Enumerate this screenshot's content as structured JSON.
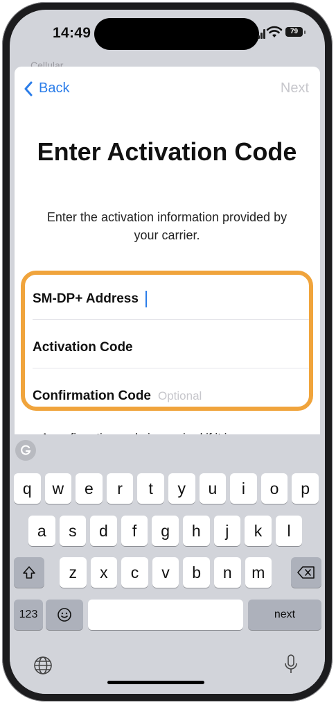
{
  "status": {
    "time": "14:49",
    "battery": "79"
  },
  "behind_title": "Cellular",
  "nav": {
    "back_label": "Back",
    "next_label": "Next"
  },
  "page": {
    "title": "Enter Activation Code",
    "subtitle": "Enter the activation information provided by your carrier."
  },
  "form": {
    "smdp_label": "SM-DP+ Address",
    "activation_label": "Activation Code",
    "confirmation_label": "Confirmation Code",
    "confirmation_placeholder": "Optional"
  },
  "peek_text": "A confirmation code is required if it is",
  "keyboard": {
    "row1": [
      "q",
      "w",
      "e",
      "r",
      "t",
      "y",
      "u",
      "i",
      "o",
      "p"
    ],
    "row2": [
      "a",
      "s",
      "d",
      "f",
      "g",
      "h",
      "j",
      "k",
      "l"
    ],
    "row3": [
      "z",
      "x",
      "c",
      "v",
      "b",
      "n",
      "m"
    ],
    "numbers_label": "123",
    "return_label": "next",
    "icons": {
      "shift": "shift-icon",
      "delete": "delete-icon",
      "emoji": "emoji-icon",
      "globe": "globe-icon",
      "mic": "microphone-icon",
      "grammarly": "grammarly-icon"
    }
  },
  "colors": {
    "accent": "#2b7de9",
    "highlight": "#f0a43c",
    "disabled": "#c7c7cc"
  }
}
